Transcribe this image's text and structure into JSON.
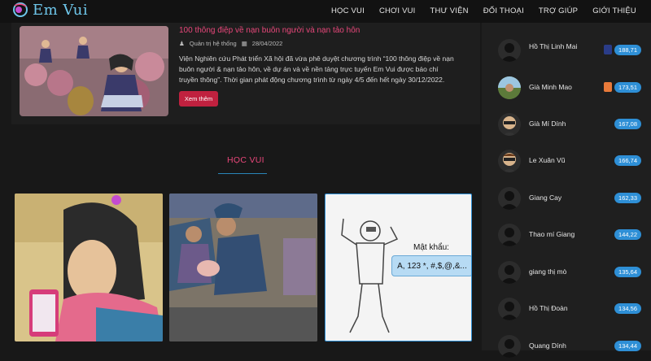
{
  "brand": {
    "name": "Em Vui"
  },
  "nav": [
    "HỌC VUI",
    "CHƠI VUI",
    "THƯ VIỆN",
    "ĐỐI THOẠI",
    "TRỢ GIÚP",
    "GIỚI THIỆU"
  ],
  "news": {
    "title": "100 thông điệp về nạn buôn người và nạn tảo hôn",
    "author": "Quản trị hệ thống",
    "date": "28/04/2022",
    "excerpt": "Viện Nghiên cứu Phát triển Xã hội đã vừa phê duyệt chương trình “100 thông điệp về nạn buôn người & nạn tảo hôn, về dự án và về nền tảng trực tuyến Em Vui được báo chí truyền thông”. Thời gian phát động chương trình từ ngày 4/5 đến hết ngày 30/12/2022.",
    "more_label": "Xem thêm"
  },
  "section": {
    "title": "HỌC VUI"
  },
  "tile3": {
    "password_label": "Mật khẩu:",
    "password_hint": "A, 123 *, #,$,@,&..."
  },
  "leaderboard": [
    {
      "name": "Hồ Thị Linh Mai",
      "score": "188,71",
      "badge": "blue"
    },
    {
      "name": "Già Minh Mao",
      "score": "173,51",
      "badge": "orange"
    },
    {
      "name": "Già Mí Dính",
      "score": "167,08"
    },
    {
      "name": "Le Xuân Vũ",
      "score": "166,74"
    },
    {
      "name": "Giang Cay",
      "score": "162,33"
    },
    {
      "name": "Thao mí Giang",
      "score": "144,22"
    },
    {
      "name": "giang thị mò",
      "score": "135,64"
    },
    {
      "name": "Hồ Thị Đoàn",
      "score": "134,56"
    },
    {
      "name": "Quang Dính",
      "score": "134,44"
    }
  ],
  "colors": {
    "accent": "#e8477a",
    "button": "#c0213f",
    "score_badge": "#2e8fd6",
    "logo": "#6ec6ea"
  }
}
